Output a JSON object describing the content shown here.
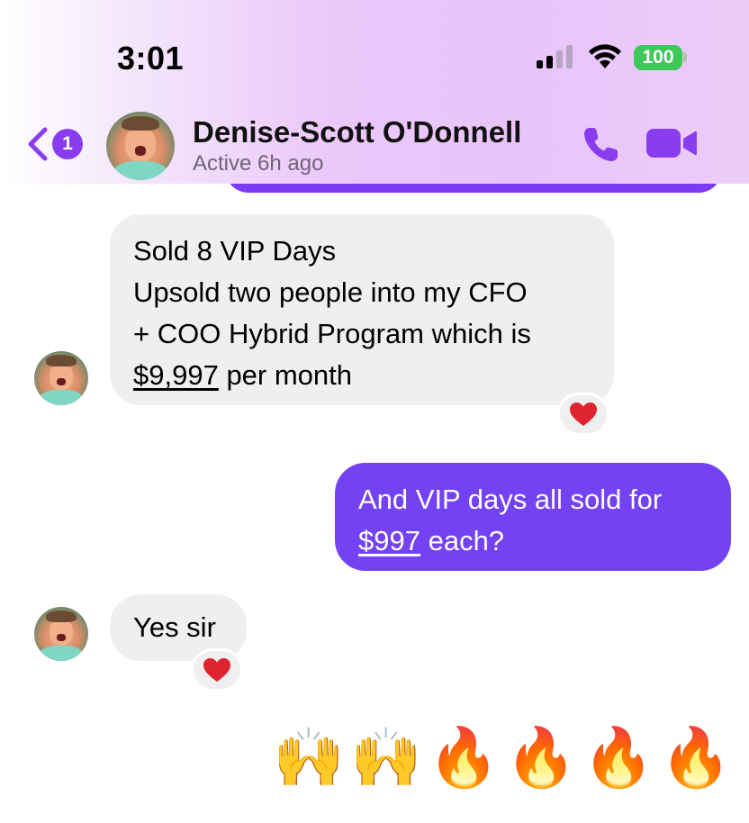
{
  "status_bar": {
    "time": "3:01",
    "battery": "100",
    "icons": [
      "cellular-signal-icon",
      "wifi-icon",
      "battery-icon"
    ]
  },
  "header": {
    "back_badge": "1",
    "contact_name": "Denise-Scott O'Donnell",
    "active_status": "Active 6h ago",
    "icons": [
      "back-chevron-icon",
      "phone-icon",
      "video-icon"
    ],
    "accent_color": "#8a3cf0"
  },
  "messages": [
    {
      "direction": "incoming",
      "lines": [
        "Sold 8 VIP Days",
        "Upsold two people into my CFO",
        "+ COO Hybrid Program which is"
      ],
      "last_line_link": "$9,997",
      "last_line_rest": " per month",
      "reaction": "heart"
    },
    {
      "direction": "outgoing",
      "line1": "And VIP days all sold for",
      "link": "$997",
      "rest": " each?"
    },
    {
      "direction": "incoming",
      "text": "Yes sir",
      "reaction": "heart"
    }
  ],
  "emoji_message": [
    "🙌",
    "🙌",
    "🔥",
    "🔥",
    "🔥",
    "🔥"
  ],
  "colors": {
    "outgoing_bubble": "#7342f3",
    "incoming_bubble": "#efeff0",
    "heart": "#e0242f"
  }
}
